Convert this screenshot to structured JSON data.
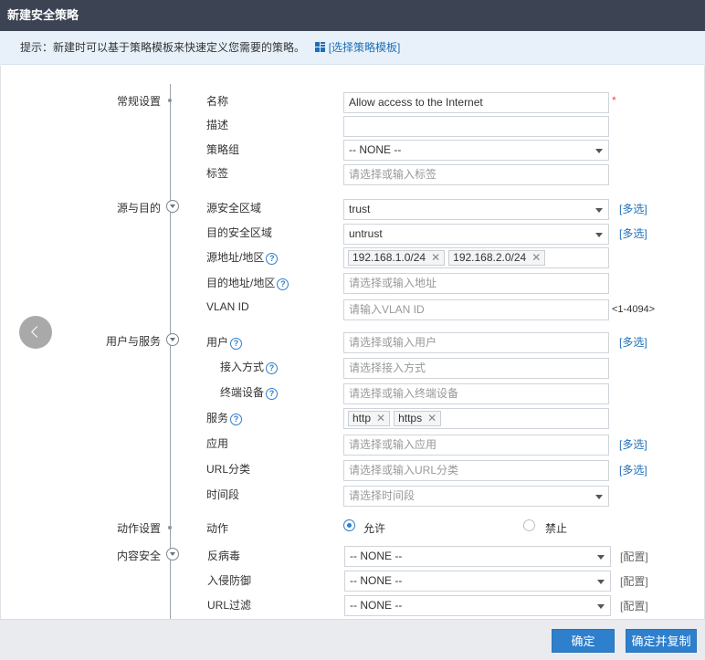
{
  "window": {
    "title": "新建安全策略"
  },
  "tip": {
    "text": "提示：新建时可以基于策略模板来快速定义您需要的策略。",
    "template_link": "[选择策略模板]"
  },
  "sections": {
    "general": "常规设置",
    "src_dst": "源与目的",
    "user_service": "用户与服务",
    "action": "动作设置",
    "content_security": "内容安全"
  },
  "fields": {
    "name": {
      "label": "名称",
      "value": "Allow access to the Internet",
      "required_mark": "*"
    },
    "desc": {
      "label": "描述",
      "value": ""
    },
    "policy_group": {
      "label": "策略组",
      "value": "-- NONE --"
    },
    "tag": {
      "label": "标签",
      "placeholder": "请选择或输入标签"
    },
    "src_zone": {
      "label": "源安全区域",
      "value": "trust"
    },
    "dst_zone": {
      "label": "目的安全区域",
      "value": "untrust"
    },
    "src_addr": {
      "label": "源地址/地区",
      "tags": [
        "192.168.1.0/24",
        "192.168.2.0/24"
      ]
    },
    "dst_addr": {
      "label": "目的地址/地区",
      "placeholder": "请选择或输入地址"
    },
    "vlan": {
      "label": "VLAN ID",
      "placeholder": "请输入VLAN ID",
      "range": "<1-4094>"
    },
    "user": {
      "label": "用户",
      "placeholder": "请选择或输入用户"
    },
    "access_mode": {
      "label": "接入方式",
      "placeholder": "请选择接入方式"
    },
    "terminal": {
      "label": "终端设备",
      "placeholder": "请选择或输入终端设备"
    },
    "service": {
      "label": "服务",
      "tags": [
        "http",
        "https"
      ]
    },
    "application": {
      "label": "应用",
      "placeholder": "请选择或输入应用"
    },
    "url_category": {
      "label": "URL分类",
      "placeholder": "请选择或输入URL分类"
    },
    "time_range": {
      "label": "时间段",
      "placeholder": "请选择时间段"
    },
    "action": {
      "label": "动作",
      "permit": "允许",
      "deny": "禁止",
      "selected": "permit"
    },
    "antivirus": {
      "label": "反病毒",
      "value": "-- NONE --"
    },
    "ips": {
      "label": "入侵防御",
      "value": "-- NONE --"
    },
    "url_filter": {
      "label": "URL过滤",
      "value": "-- NONE --"
    }
  },
  "links": {
    "multi_select": "[多选]",
    "config": "[配置]"
  },
  "tag_remove": "✕",
  "help_glyph": "?",
  "footer": {
    "ok": "确定",
    "ok_copy": "确定并复制"
  },
  "colors": {
    "titlebar": "#3c4353",
    "accent": "#2e7fcc",
    "link": "#1f6fb8",
    "required": "#e84a4a"
  }
}
